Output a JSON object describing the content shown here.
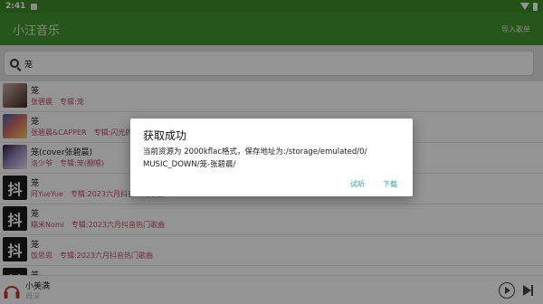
{
  "status_bar": {
    "time": "2:41"
  },
  "app_bar": {
    "title": "小汪音乐",
    "import_label": "导入歌单"
  },
  "search": {
    "value": "笼"
  },
  "songs": [
    {
      "title": "笼",
      "artist": "张碧晨",
      "album": "专辑:笼",
      "cover_text": ""
    },
    {
      "title": "笼",
      "artist": "张碧晨&CAPPER",
      "album": "专辑:闪光的乐队 第6期",
      "cover_text": ""
    },
    {
      "title": "笼(cover张碧晨)",
      "artist": "洛少爷",
      "album": "专辑:笼(翻唱)",
      "cover_text": ""
    },
    {
      "title": "笼",
      "artist": "阿YueYue",
      "album": "专辑:2023六月抖音热门歌曲",
      "cover_text": "抖"
    },
    {
      "title": "笼",
      "artist": "糯米Nomi",
      "album": "专辑:2023六月抖音热门歌曲",
      "cover_text": "抖"
    },
    {
      "title": "笼",
      "artist": "饭思思",
      "album": "专辑:2023六月抖音热门歌曲",
      "cover_text": "抖"
    },
    {
      "title": "笼",
      "artist": "",
      "album": "",
      "cover_text": "抖"
    }
  ],
  "player": {
    "title": "小美满",
    "artist": "周深"
  },
  "dialog": {
    "title": "获取成功",
    "message_line1": "当前资源为 2000kflac格式，保存地址为:/storage/emulated/0/",
    "message_line2": "MUSIC_DOWN/笼-张碧晨/",
    "try_label": "试听",
    "download_label": "下载"
  }
}
